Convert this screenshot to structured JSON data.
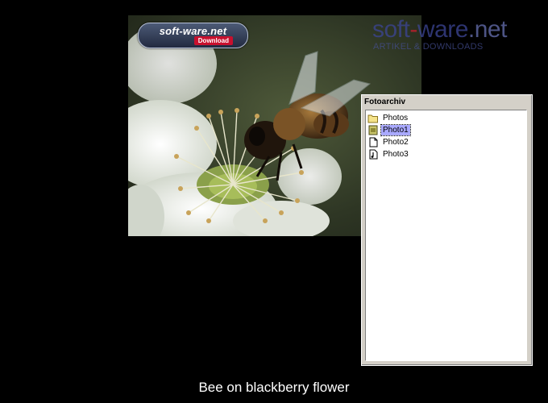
{
  "watermark": {
    "badge_title": "soft-ware.net",
    "badge_subtitle": "Download",
    "logo_soft": "soft",
    "logo_dash": "-",
    "logo_ware": "ware",
    "logo_net": ".net",
    "logo_tagline": "ARTIKEL & DOWNLOADS"
  },
  "panel": {
    "title": "Fotoarchiv",
    "items": [
      {
        "label": "Photos",
        "icon": "folder-icon"
      },
      {
        "label": "Photo1",
        "icon": "photo-file-icon",
        "selected": true
      },
      {
        "label": "Photo2",
        "icon": "document-icon"
      },
      {
        "label": "Photo3",
        "icon": "audio-file-icon"
      }
    ]
  },
  "caption": "Bee on blackberry flower",
  "colors": {
    "background": "#000000",
    "selection": "#a9a9ff",
    "panel": "#d4d0c8"
  }
}
